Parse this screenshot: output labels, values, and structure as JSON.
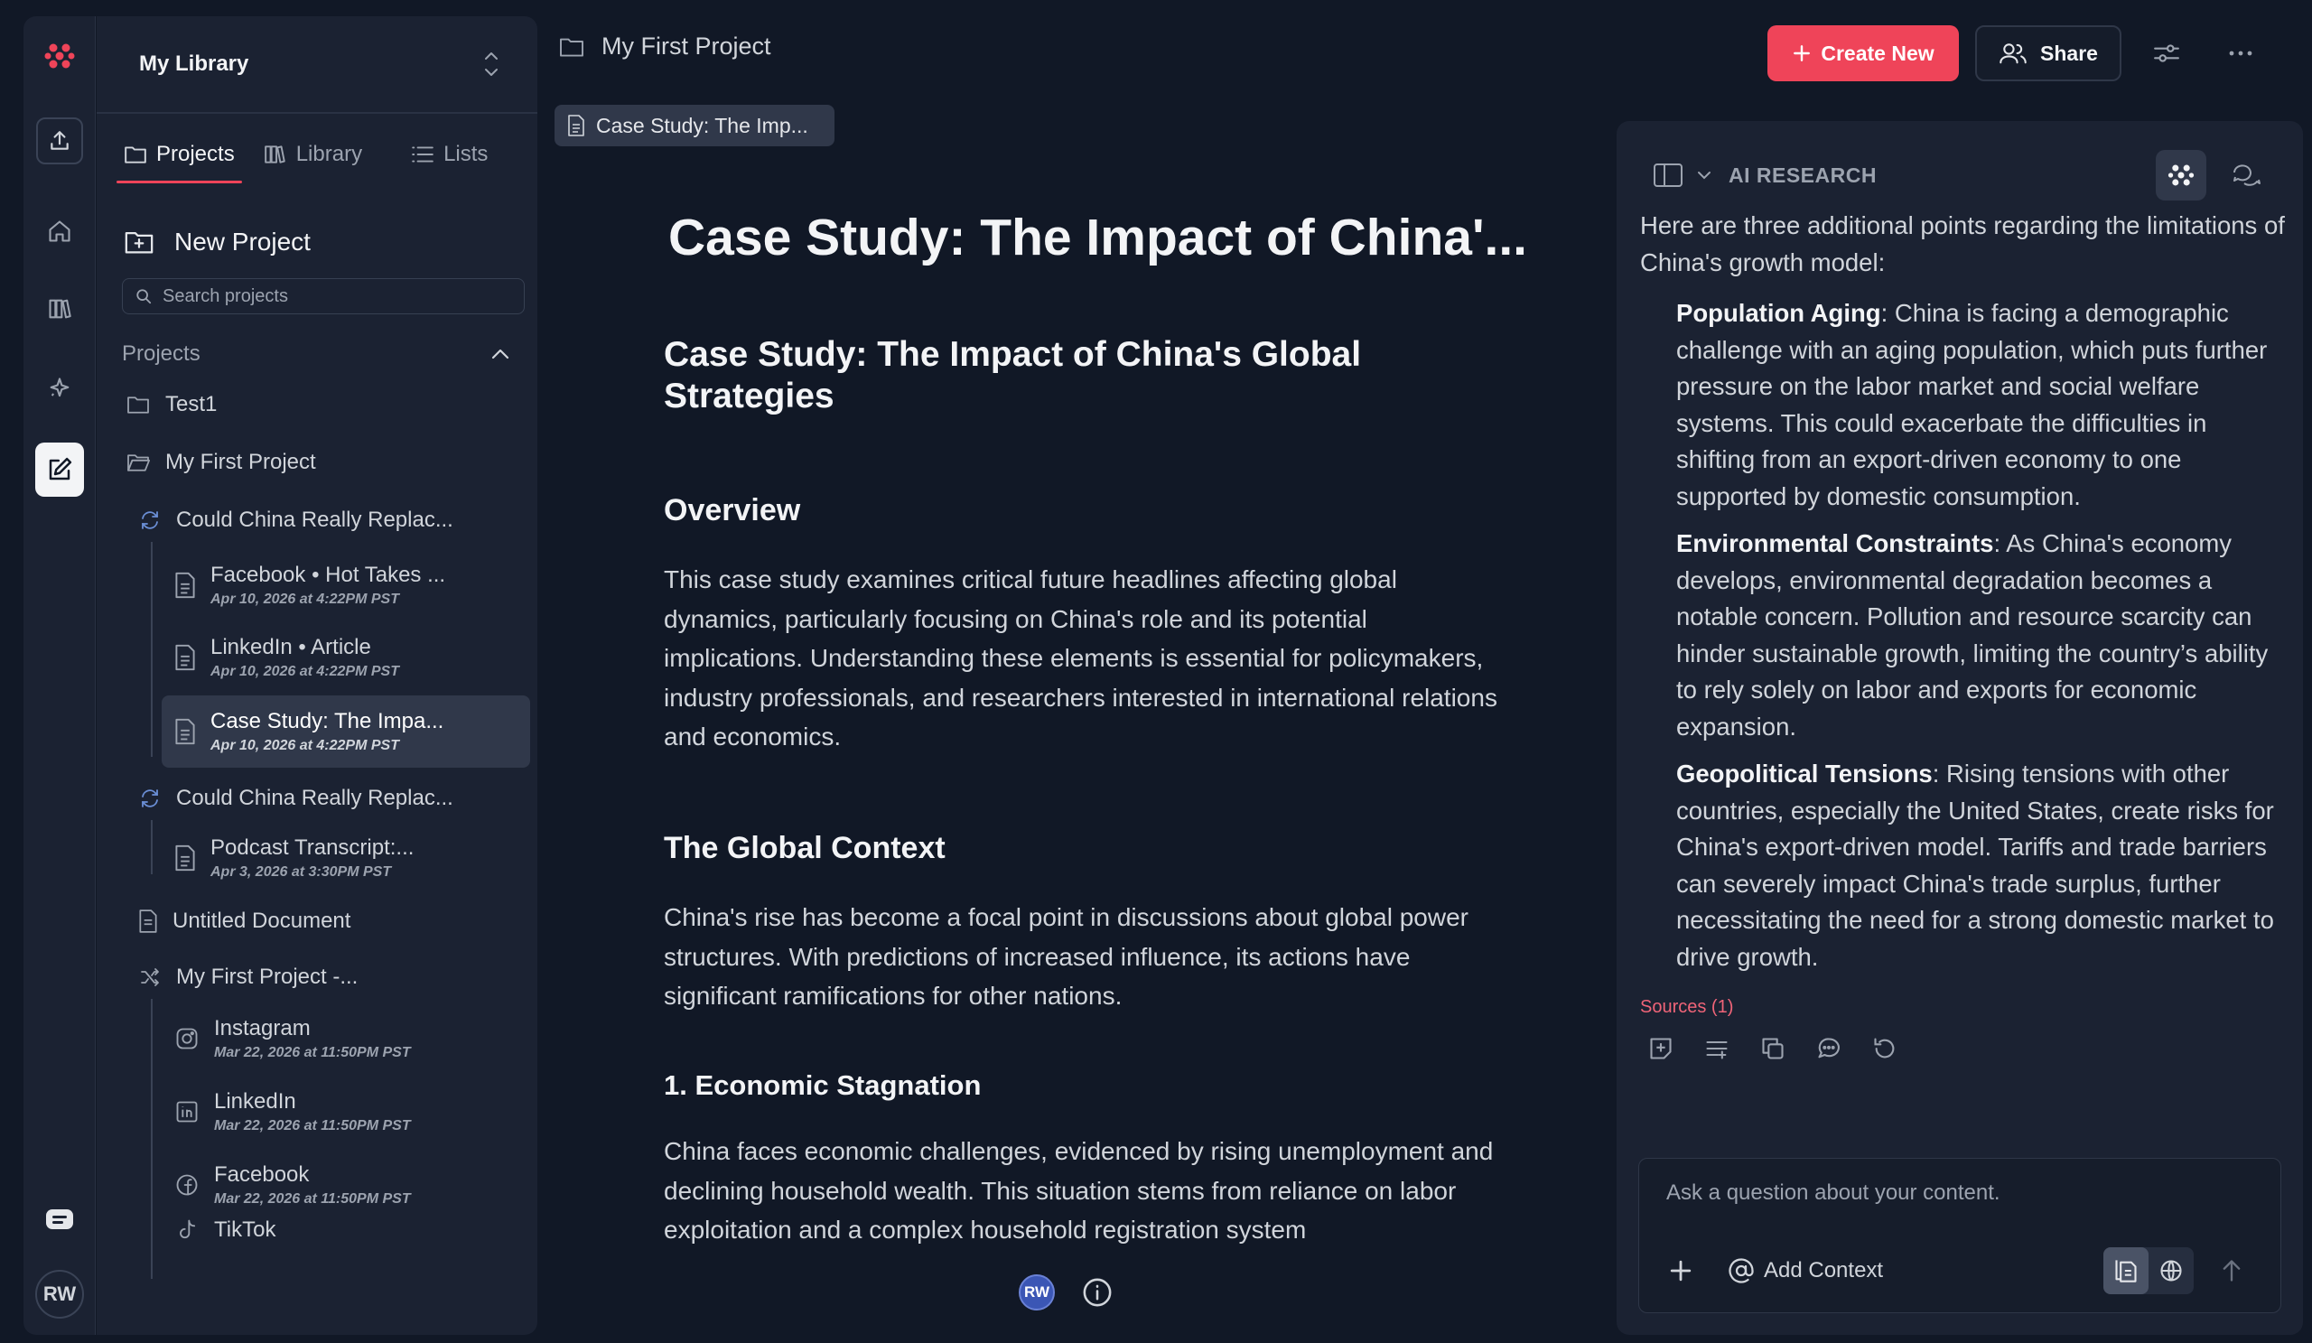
{
  "rail": {
    "avatar_initials": "RW",
    "brand_color": "#ef4459"
  },
  "sidebar": {
    "library_title": "My Library",
    "tabs": [
      {
        "label": "Projects",
        "icon": "folder-icon",
        "active": true
      },
      {
        "label": "Library",
        "icon": "books-icon",
        "active": false
      },
      {
        "label": "Lists",
        "icon": "list-icon",
        "active": false
      }
    ],
    "new_project_label": "New Project",
    "search_placeholder": "Search projects",
    "section_title": "Projects",
    "tree": {
      "test1": "Test1",
      "my_first_project": "My First Project",
      "group1": "Could China Really Replac...",
      "docs1": [
        {
          "title": "Facebook • Hot Takes ...",
          "date": "Apr 10, 2026 at 4:22PM PST"
        },
        {
          "title": "LinkedIn • Article",
          "date": "Apr 10, 2026 at 4:22PM PST"
        },
        {
          "title": "Case Study: The Impa...",
          "date": "Apr 10, 2026 at 4:22PM PST"
        }
      ],
      "group2": "Could China Really Replac...",
      "docs2": [
        {
          "title": "Podcast Transcript:...",
          "date": "Apr 3, 2026 at 3:30PM PST"
        }
      ],
      "untitled": "Untitled Document",
      "group3": "My First Project -...",
      "docs3": [
        {
          "title": "Instagram",
          "date": "Mar 22, 2026 at 11:50PM PST"
        },
        {
          "title": "LinkedIn",
          "date": "Mar 22, 2026 at 11:50PM PST"
        },
        {
          "title": "Facebook",
          "date": "Mar 22, 2026 at 11:50PM PST"
        },
        {
          "title": "TikTok",
          "date": ""
        }
      ]
    }
  },
  "topbar": {
    "breadcrumb": "My First Project",
    "create_label": "Create New",
    "share_label": "Share"
  },
  "doc_tab": "Case Study: The Imp...",
  "editor": {
    "heading": "Case Study: The Impact of China'...",
    "h1": "Case Study: The Impact of China's Global Strategies",
    "overview_title": "Overview",
    "overview_text": "This case study examines critical future headlines affecting global dynamics, particularly focusing on China's role and its potential implications. Understanding these elements is essential for policymakers, industry professionals, and researchers interested in international relations and economics.",
    "context_title": "The Global Context",
    "context_text": "China's rise has become a focal point in discussions about global power structures. With predictions of increased influence, its actions have significant ramifications for other nations.",
    "stagnation_title": "1. Economic Stagnation",
    "stagnation_text": "China faces economic challenges, evidenced by rising unemployment and declining household wealth. This situation stems from reliance on labor exploitation and a complex household registration system",
    "avatar": "RW"
  },
  "ai": {
    "title": "AI RESEARCH",
    "intro": "Here are three additional points regarding the limitations of China's growth model:",
    "points": [
      {
        "term": "Population Aging",
        "text": ": China is facing a demographic challenge with an aging population, which puts further pressure on the labor market and social welfare systems. This could exacerbate the difficulties in shifting from an export-driven economy to one supported by domestic consumption."
      },
      {
        "term": "Environmental Constraints",
        "text": ": As China's economy develops, environmental degradation becomes a notable concern. Pollution and resource scarcity can hinder sustainable growth, limiting the country’s ability to rely solely on labor and exports for economic expansion."
      },
      {
        "term": "Geopolitical Tensions",
        "text": ": Rising tensions with other countries, especially the United States, create risks for China's export-driven model. Tariffs and trade barriers can severely impact China's trade surplus, further necessitating the need for a strong domestic market to drive growth."
      }
    ],
    "sources": "Sources (1)",
    "ask_placeholder": "Ask a question about your content.",
    "add_context": "Add Context"
  }
}
